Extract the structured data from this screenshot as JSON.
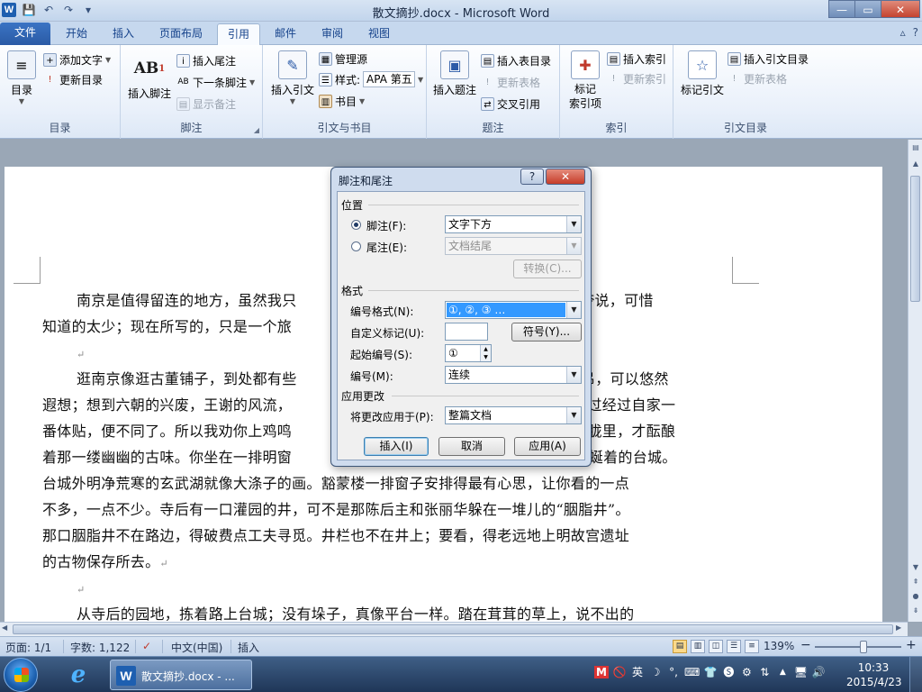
{
  "window": {
    "title": "散文摘抄.docx - Microsoft Word",
    "app_icon": "W",
    "controls": {
      "minimize": "—",
      "maximize": "▭",
      "close": "✕"
    }
  },
  "quick_access": {
    "save_icon": "💾",
    "undo_icon": "↶",
    "redo_icon": "↷",
    "customize_icon": "▾"
  },
  "ribbon_tabs": [
    "文件",
    "开始",
    "插入",
    "页面布局",
    "引用",
    "邮件",
    "审阅",
    "视图"
  ],
  "active_tab": "引用",
  "ribbon_right": {
    "minimize_ribbon": "▵",
    "help": "?"
  },
  "ribbon": {
    "toc": {
      "button": "目录",
      "add_text": "添加文字",
      "update_toc": "更新目录",
      "group_label": "目录"
    },
    "footnotes": {
      "insert_footnote": "插入脚注",
      "insert_endnote": "插入尾注",
      "next_footnote": "下一条脚注",
      "show_notes": "显示备注",
      "group_label": "脚注",
      "ab_glyph": "AB",
      "ab_sup": "1"
    },
    "citations": {
      "insert_citation": "插入引文",
      "manage_sources": "管理源",
      "style_label": "样式:",
      "style_value": "APA 第五",
      "bibliography": "书目",
      "group_label": "引文与书目"
    },
    "captions": {
      "insert_caption": "插入题注",
      "insert_table_of_figures": "插入表目录",
      "update_table": "更新表格",
      "cross_reference": "交叉引用",
      "group_label": "题注"
    },
    "index": {
      "mark_entry": "标记\n索引项",
      "insert_index": "插入索引",
      "update_index": "更新索引",
      "group_label": "索引"
    },
    "authorities": {
      "mark_citation": "标记引文",
      "insert_table_of_authorities": "插入引文目录",
      "update_table": "更新表格",
      "group_label": "引文目录"
    }
  },
  "document": {
    "paragraphs": [
      [
        "南京是值得留连的地方，虽然我只",
        "想夸说夸说，可惜",
        "知道的太少；现在所写的，只是一个旅"
      ],
      [
        "逛南京像逛古董铺子，到处都有些",
        "以凭吊，可以悠然",
        "遐想；想到六朝的兴废，王谢的风流，",
        "，不过经过自家一",
        "番体贴，便不同了。所以我劝你上鸡鸣",
        "在朦胧里，才酝酿",
        "着那一缕幽幽的古味。你坐在一排明窗",
        "宛然蜿蜒着的台城。"
      ],
      [
        "台城外明净荒寒的玄武湖就像大涤子的画。豁蒙楼一排窗子安排得最有心思，让你看的一点",
        "不多，一点不少。寺后有一口灌园的井，可不是那陈后主和张丽华躲在一堆儿的“胭脂井”。",
        "那口胭脂井不在路边，得破费点工夫寻觅。井栏也不在井上；要看，得老远地上明故宫遗址",
        "的古物保存所去。"
      ],
      [
        "从寺后的园地，拣着路上台城；没有垛子，真像平台一样。踏在茸茸的草上，说不出的"
      ]
    ],
    "paragraph_mark": "↵"
  },
  "dialog": {
    "title": "脚注和尾注",
    "help_button": "?",
    "close_button": "✕",
    "location_section": "位置",
    "footnote_label": "脚注(F):",
    "footnote_value": "文字下方",
    "endnote_label": "尾注(E):",
    "endnote_value": "文档结尾",
    "convert_button": "转换(C)...",
    "format_section": "格式",
    "number_format_label": "编号格式(N):",
    "number_format_value": "①, ②, ③ …",
    "custom_mark_label": "自定义标记(U):",
    "custom_mark_value": "",
    "symbol_button": "符号(Y)...",
    "start_at_label": "起始编号(S):",
    "start_at_value": "①",
    "numbering_label": "编号(M):",
    "numbering_value": "连续",
    "apply_section": "应用更改",
    "apply_to_label": "将更改应用于(P):",
    "apply_to_value": "整篇文档",
    "insert_button": "插入(I)",
    "cancel_button": "取消",
    "apply_button": "应用(A)",
    "selected_location": "footnote"
  },
  "statusbar": {
    "page": "页面: 1/1",
    "words": "字数: 1,122",
    "language": "中文(中国)",
    "mode": "插入",
    "zoom": "139%",
    "zoom_out": "−",
    "zoom_in": "+"
  },
  "taskbar": {
    "word_task": "散文摘抄.docx - ...",
    "tray": [
      "M",
      "🚫",
      "英",
      "☽",
      "°,",
      "⌨",
      "👕",
      "🅢",
      "⚙",
      "⇅",
      "▲",
      "🖥",
      "🔊"
    ],
    "time": "10:33",
    "date": "2015/4/23"
  }
}
